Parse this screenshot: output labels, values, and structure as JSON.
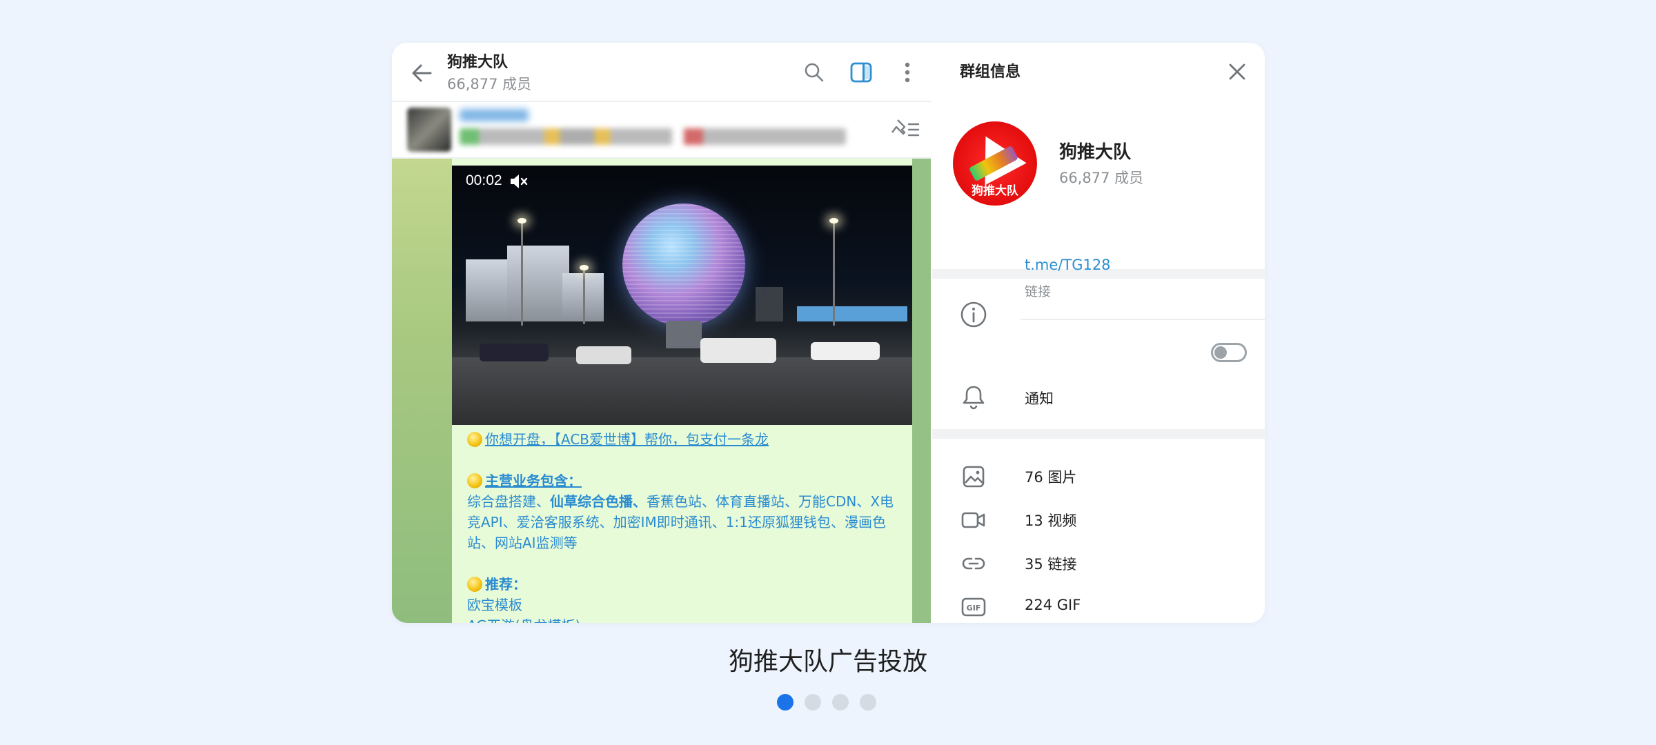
{
  "chat": {
    "title": "狗推大队",
    "members": "66,877 成员"
  },
  "video": {
    "time": "00:02"
  },
  "message": {
    "line1": "你想开盘，【ACB爱世博】帮你，包支付一条龙",
    "services_heading": "主营业务包含：",
    "services_part1": "综合盘搭建、",
    "services_bold": "仙草综合色播、",
    "services_part2": "香蕉色站、体育直播站、万能CDN、X电竞API、爱洽客服系统、加密IM即时通讯、1:1还原狐狸钱包、漫画色站、网站AI监测等",
    "recommend_heading": "推荐：",
    "recommend_item1": "欧宝模板",
    "recommend_item2": "AG亚游(盘龙模板)"
  },
  "info": {
    "title": "群组信息",
    "group_name": "狗推大队",
    "group_members": "66,877 成员",
    "avatar_text": "狗推大队",
    "link": "t.me/TG128",
    "link_label": "链接",
    "notify_label": "通知",
    "notify_on": false,
    "media": {
      "photos": "76 图片",
      "videos": "13 视频",
      "links": "35 链接",
      "gifs": "224 GIF"
    }
  },
  "caption": "狗推大队广告投放",
  "carousel": {
    "count": 4,
    "active": 0
  },
  "colors": {
    "background": "#edf4fd",
    "accent": "#2b8fd1",
    "dot_active": "#1a73e8",
    "bubble": "#e7fbd8"
  },
  "icons": [
    "back-arrow-icon",
    "search-icon",
    "sidebar-toggle-icon",
    "more-vertical-icon",
    "pin-list-icon",
    "mute-icon",
    "close-icon",
    "info-icon",
    "bell-icon",
    "image-icon",
    "video-icon",
    "link-icon",
    "gif-icon"
  ]
}
